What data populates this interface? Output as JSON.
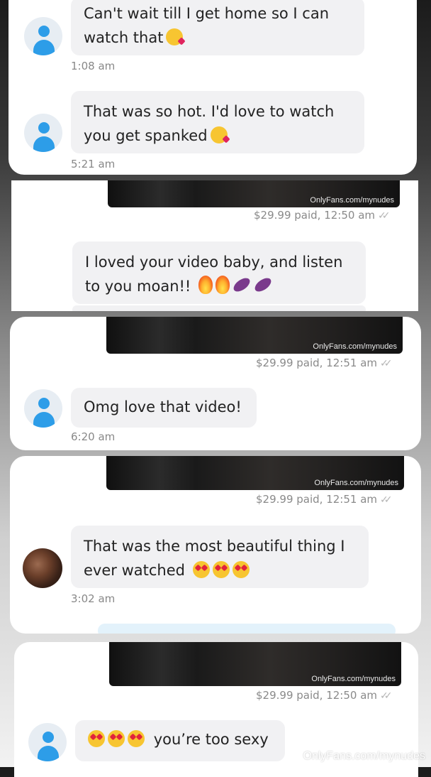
{
  "messages": {
    "m1": {
      "text": "Can't wait till I get home so I can watch that",
      "time": "1:08 am",
      "emoji": "kiss-icon"
    },
    "m2": {
      "text": "That was so hot. I'd love to watch you get spanked",
      "time": "5:21 am",
      "emoji": "kiss-icon"
    },
    "m3": {
      "text": "I loved your video baby, and listen to you moan!!",
      "emoji": [
        "fire-icon",
        "fire-icon",
        "eggplant-icon",
        "eggplant-icon"
      ]
    },
    "m4": {
      "text": "Omg love that video!",
      "time": "6:20 am"
    },
    "m5": {
      "text": "That was the most beautiful thing I ever watched",
      "time": "3:02 am",
      "emoji": [
        "heart-eyes-icon",
        "heart-eyes-icon",
        "heart-eyes-icon"
      ]
    },
    "m6": {
      "text": "you’re too sexy",
      "emoji": [
        "heart-eyes-icon",
        "heart-eyes-icon",
        "heart-eyes-icon"
      ]
    }
  },
  "media": {
    "watermark": "OnlyFans.com/mynudes",
    "paid1": "$29.99 paid, 12:50 am",
    "paid2": "$29.99 paid, 12:51 am",
    "paid3": "$29.99 paid, 12:51 am",
    "paid4": "$29.99 paid, 12:50 am"
  },
  "footer_watermark": "OnlyFans.com/mynudes",
  "colors": {
    "avatar_blue": "#2d9de8",
    "bubble_bg": "#f1f1f3",
    "time_gray": "#888888"
  }
}
